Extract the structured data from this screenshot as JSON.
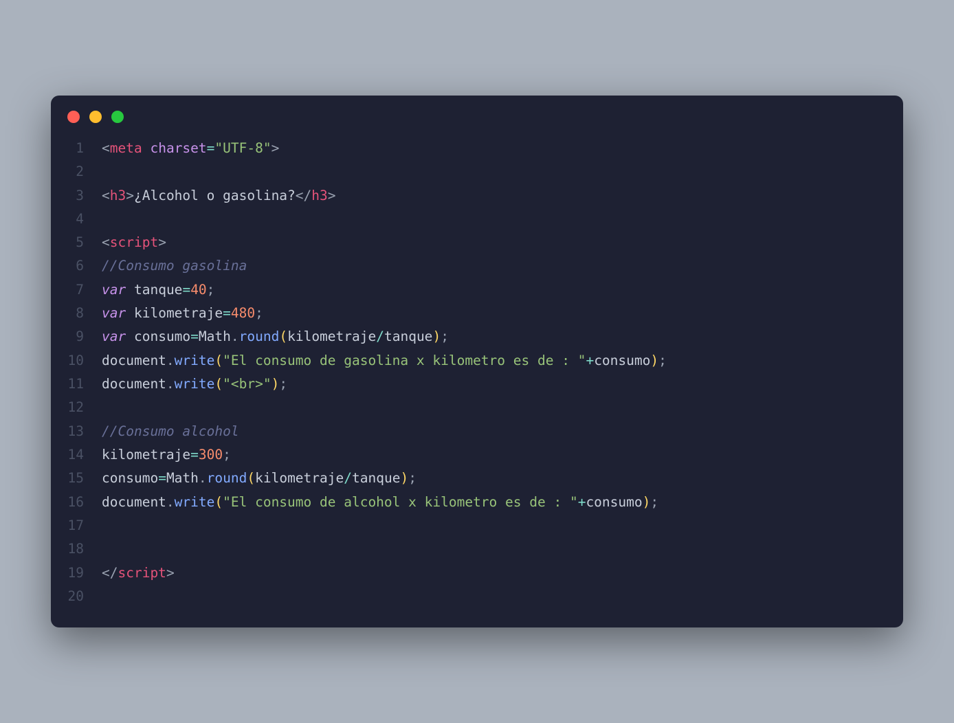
{
  "lines": [
    {
      "n": "1",
      "tokens": [
        [
          "angle",
          "<"
        ],
        [
          "tag",
          "meta"
        ],
        [
          "text",
          " "
        ],
        [
          "attr",
          "charset"
        ],
        [
          "op",
          "="
        ],
        [
          "str",
          "\"UTF-8\""
        ],
        [
          "angle",
          ">"
        ]
      ]
    },
    {
      "n": "2",
      "tokens": []
    },
    {
      "n": "3",
      "tokens": [
        [
          "angle",
          "<"
        ],
        [
          "tag",
          "h3"
        ],
        [
          "angle",
          ">"
        ],
        [
          "text",
          "¿Alcohol o gasolina?"
        ],
        [
          "angle",
          "</"
        ],
        [
          "tag",
          "h3"
        ],
        [
          "angle",
          ">"
        ]
      ]
    },
    {
      "n": "4",
      "tokens": []
    },
    {
      "n": "5",
      "tokens": [
        [
          "angle",
          "<"
        ],
        [
          "tag",
          "script"
        ],
        [
          "angle",
          ">"
        ]
      ]
    },
    {
      "n": "6",
      "tokens": [
        [
          "comment",
          "//Consumo gasolina"
        ]
      ]
    },
    {
      "n": "7",
      "tokens": [
        [
          "kw",
          "var"
        ],
        [
          "text",
          " "
        ],
        [
          "ident",
          "tanque"
        ],
        [
          "op",
          "="
        ],
        [
          "num",
          "40"
        ],
        [
          "punct",
          ";"
        ]
      ]
    },
    {
      "n": "8",
      "tokens": [
        [
          "kw",
          "var"
        ],
        [
          "text",
          " "
        ],
        [
          "ident",
          "kilometraje"
        ],
        [
          "op",
          "="
        ],
        [
          "num",
          "480"
        ],
        [
          "punct",
          ";"
        ]
      ]
    },
    {
      "n": "9",
      "tokens": [
        [
          "kw",
          "var"
        ],
        [
          "text",
          " "
        ],
        [
          "ident",
          "consumo"
        ],
        [
          "op",
          "="
        ],
        [
          "obj",
          "Math"
        ],
        [
          "dot",
          "."
        ],
        [
          "func",
          "round"
        ],
        [
          "paren",
          "("
        ],
        [
          "ident",
          "kilometraje"
        ],
        [
          "op",
          "/"
        ],
        [
          "ident",
          "tanque"
        ],
        [
          "paren",
          ")"
        ],
        [
          "punct",
          ";"
        ]
      ]
    },
    {
      "n": "10",
      "tokens": [
        [
          "obj",
          "document"
        ],
        [
          "dot",
          "."
        ],
        [
          "func",
          "write"
        ],
        [
          "paren",
          "("
        ],
        [
          "str",
          "\"El consumo de gasolina x kilometro es de : \""
        ],
        [
          "op",
          "+"
        ],
        [
          "ident",
          "consumo"
        ],
        [
          "paren",
          ")"
        ],
        [
          "punct",
          ";"
        ]
      ]
    },
    {
      "n": "11",
      "tokens": [
        [
          "obj",
          "document"
        ],
        [
          "dot",
          "."
        ],
        [
          "func",
          "write"
        ],
        [
          "paren",
          "("
        ],
        [
          "str",
          "\"<br>\""
        ],
        [
          "paren",
          ")"
        ],
        [
          "punct",
          ";"
        ]
      ]
    },
    {
      "n": "12",
      "tokens": []
    },
    {
      "n": "13",
      "tokens": [
        [
          "comment",
          "//Consumo alcohol"
        ]
      ]
    },
    {
      "n": "14",
      "tokens": [
        [
          "ident",
          "kilometraje"
        ],
        [
          "op",
          "="
        ],
        [
          "num",
          "300"
        ],
        [
          "punct",
          ";"
        ]
      ]
    },
    {
      "n": "15",
      "tokens": [
        [
          "ident",
          "consumo"
        ],
        [
          "op",
          "="
        ],
        [
          "obj",
          "Math"
        ],
        [
          "dot",
          "."
        ],
        [
          "func",
          "round"
        ],
        [
          "paren",
          "("
        ],
        [
          "ident",
          "kilometraje"
        ],
        [
          "op",
          "/"
        ],
        [
          "ident",
          "tanque"
        ],
        [
          "paren",
          ")"
        ],
        [
          "punct",
          ";"
        ]
      ]
    },
    {
      "n": "16",
      "tokens": [
        [
          "obj",
          "document"
        ],
        [
          "dot",
          "."
        ],
        [
          "func",
          "write"
        ],
        [
          "paren",
          "("
        ],
        [
          "str",
          "\"El consumo de alcohol x kilometro es de : \""
        ],
        [
          "op",
          "+"
        ],
        [
          "ident",
          "consumo"
        ],
        [
          "paren",
          ")"
        ],
        [
          "punct",
          ";"
        ]
      ]
    },
    {
      "n": "17",
      "tokens": []
    },
    {
      "n": "18",
      "tokens": []
    },
    {
      "n": "19",
      "tokens": [
        [
          "angle",
          "</"
        ],
        [
          "tag",
          "script"
        ],
        [
          "angle",
          ">"
        ]
      ]
    },
    {
      "n": "20",
      "tokens": []
    }
  ]
}
